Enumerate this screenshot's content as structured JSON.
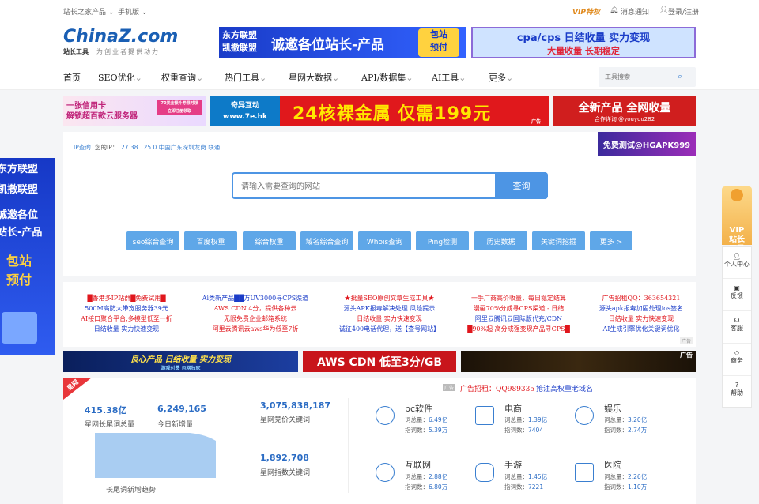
{
  "topbar": {
    "left_items": [
      "站长之家产品",
      "手机版"
    ],
    "vip": "VIP特权",
    "messages": "消息通知",
    "login": "登录/注册"
  },
  "logo": {
    "text": "ChinaZ.com",
    "sub": "站长工具",
    "slogan": "为创业者提供动力"
  },
  "header_ads": [
    {
      "left": "东方联盟\n凯撒联盟",
      "main": "诚邀各位站长-产品",
      "badge": "包站\n预付"
    },
    {
      "line1": "cpa/cps 日结收量 实力变现",
      "line2": "大量收量 长期稳定"
    }
  ],
  "nav": {
    "items": [
      "首页",
      "SEO优化",
      "权重查询",
      "热门工具",
      "星网大数据",
      "API/数据集",
      "AI工具",
      "更多"
    ],
    "search_placeholder": "工具搜索"
  },
  "banner_ads": [
    {
      "main": "一张信用卡\n解锁超百款云服务器",
      "side": "70美金额外券限时领\n立即注册领取"
    },
    {
      "brand": "奇异互动\nwww.7e.hk",
      "main": "24核裸金属 仅需199元",
      "tag": "广告"
    },
    {
      "main": "全新产品 全网收量",
      "sub": "合作详询 @youyou282"
    }
  ],
  "ip": {
    "label": "IP查询",
    "prefix": "您的IP：",
    "value": "27.38.125.0 中国广东深圳龙岗 联通",
    "ad": "免费测试@HGAPK999"
  },
  "search": {
    "placeholder": "请输入需要查询的网站",
    "button": "查询"
  },
  "quick_buttons": [
    "seo综合查询",
    "百度权重",
    "综合权重",
    "域名综合查询",
    "Whois查询",
    "Ping检测",
    "历史数据",
    "关键词挖掘",
    "更多 >"
  ],
  "text_ads": [
    [
      "█香港多IP站群█免费试用█",
      "500M高防大带宽服务器39元",
      "AI接口聚合平台,多模型低至一折",
      "日结收量 实力快速变现"
    ],
    [
      "Ai类新产品██万UV3000寻CPS渠道",
      "AWS CDN 4分，提供各种云",
      "无限免费企业邮箱系统",
      "阿里云腾讯云aws华为低至7折"
    ],
    [
      "★批量SEO原创文章生成工具★",
      "源头APK报毒解决处理 风险提示",
      "日结收量 实力快速变现",
      "诚征400电话代理，送【查号网站】"
    ],
    [
      "一手厂商高价收量，每日稳定结算",
      "漫画70%分成寻CPS渠道 - 日结",
      "阿里云腾讯云国际版代充/CDN",
      "█90%起 高分成强变现产品寻CPS█"
    ],
    [
      "广告招租QQ：363654321",
      "源头apk报毒加固处理ios签名",
      "日结收量 实力快速变现",
      "AI生成引擎优化关键词优化"
    ]
  ],
  "ad_tag": "广告",
  "wide_ads": [
    {
      "main": "良心产品 日结收量 实力变现",
      "sub": "游戏付费  包网独家"
    },
    {
      "main": "AWS CDN 低至3分/GB"
    },
    {
      "main": "广告"
    }
  ],
  "rent_ad": {
    "tag": "广告",
    "text": "广告招租：QQ989335",
    "link": "抢注高权重老域名"
  },
  "stats": {
    "ribbon": "星网",
    "total": "415.38亿",
    "total_label": "星网长尾词总量",
    "new": "6,249,165",
    "new_label": "今日新增量",
    "chart_label": "长尾词新增趋势",
    "bid": "3,075,838,187",
    "bid_label": "星网竞价关键词",
    "index": "1,892,708",
    "index_label": "星网指数关键词"
  },
  "categories": [
    {
      "name": "pc软件",
      "total": "6.49亿",
      "index": "5.39万"
    },
    {
      "name": "电商",
      "total": "1.39亿",
      "index": "7404"
    },
    {
      "name": "娱乐",
      "total": "3.20亿",
      "index": "2.74万"
    },
    {
      "name": "互联网",
      "total": "2.88亿",
      "index": "6.80万"
    },
    {
      "name": "手游",
      "total": "1.45亿",
      "index": "7221"
    },
    {
      "name": "医院",
      "total": "2.26亿",
      "index": "1.10万"
    }
  ],
  "cat_labels": {
    "total": "词总量：",
    "index": "指词数："
  },
  "left_float": {
    "l1": "东方联盟",
    "l2": "凯撒联盟",
    "l3": "诚邀各位",
    "l4": "站长-产品",
    "l5": "包站",
    "l6": "预付"
  },
  "sidebar": {
    "vip": "VIP\n站长\n工具",
    "items": [
      "个人中心",
      "反馈",
      "客服",
      "商务",
      "帮助"
    ]
  }
}
